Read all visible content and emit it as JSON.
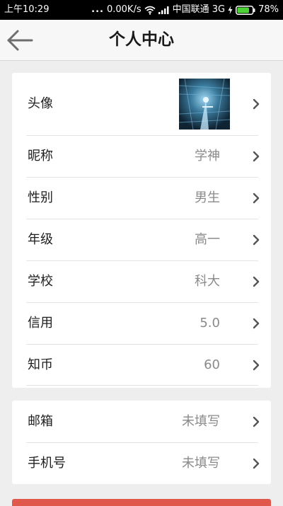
{
  "status_bar": {
    "time": "上午10:29",
    "dots": "...",
    "network_speed": "0.00K/s",
    "carrier": "中国联通 3G",
    "battery": "78%",
    "icons": [
      "wifi-icon",
      "signal-icon",
      "charge-icon",
      "battery-icon"
    ]
  },
  "header": {
    "title": "个人中心",
    "back_icon": "arrow-left-icon"
  },
  "profile": {
    "rows": [
      {
        "label": "头像",
        "value": ""
      },
      {
        "label": "昵称",
        "value": "学神"
      },
      {
        "label": "性别",
        "value": "男生"
      },
      {
        "label": "年级",
        "value": "高一"
      },
      {
        "label": "学校",
        "value": "科大"
      },
      {
        "label": "信用",
        "value": "5.0"
      },
      {
        "label": "知币",
        "value": "60"
      }
    ]
  },
  "contact": {
    "rows": [
      {
        "label": "邮箱",
        "value": "未填写"
      },
      {
        "label": "手机号",
        "value": "未填写"
      }
    ]
  },
  "colors": {
    "status_bar": "#000000",
    "header_bg": "#f7f7f7",
    "page_bg": "#eeeeee",
    "value_text": "#8a8a8a",
    "bottom_button": "#e0574c"
  }
}
